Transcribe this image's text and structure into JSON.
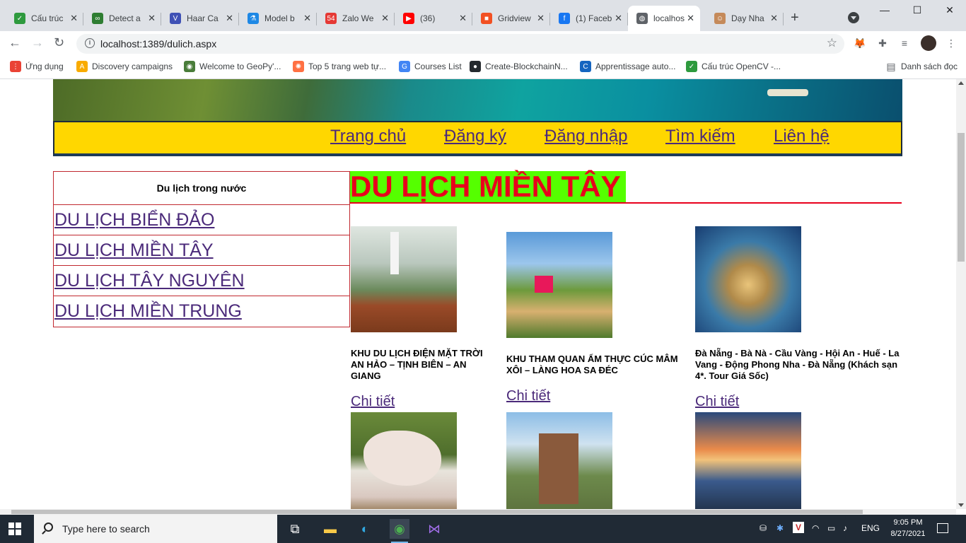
{
  "browser": {
    "tabs": [
      {
        "title": "Cấu trúc",
        "icon_color": "#2e9a3e",
        "glyph": "✓"
      },
      {
        "title": "Detect a",
        "icon_color": "#2e7d32",
        "glyph": "∞"
      },
      {
        "title": "Haar Ca",
        "icon_color": "#3f51b5",
        "glyph": "V"
      },
      {
        "title": "Model b",
        "icon_color": "#1e88e5",
        "glyph": "⚗"
      },
      {
        "title": "Zalo We",
        "icon_color": "#e53935",
        "glyph": "54"
      },
      {
        "title": "(36)",
        "icon_color": "#ff0000",
        "glyph": "▶"
      },
      {
        "title": "Gridview",
        "icon_color": "#f25022",
        "glyph": "■"
      },
      {
        "title": "(1) Faceb",
        "icon_color": "#1877f2",
        "glyph": "f"
      },
      {
        "title": "localhos",
        "icon_color": "#5f6368",
        "glyph": "◍",
        "active": true
      },
      {
        "title": "Dạy Nha",
        "icon_color": "#c58a5a",
        "glyph": "☺"
      }
    ],
    "new_tab": "+",
    "window": {
      "minimize": "—",
      "maximize": "☐",
      "close": "✕"
    },
    "nav": {
      "back": "←",
      "forward": "→",
      "reload": "↻"
    },
    "url": "localhost:1389/dulich.aspx",
    "bookmarks": [
      {
        "label": "Ứng dụng",
        "color": "#ea4335",
        "glyph": "⋮⋮⋮"
      },
      {
        "label": "Discovery campaigns",
        "color": "#f9ab00",
        "glyph": "A"
      },
      {
        "label": "Welcome to GeoPy'...",
        "color": "#4a7d3a",
        "glyph": "◉"
      },
      {
        "label": "Top 5 trang web tự...",
        "color": "#ff7043",
        "glyph": "✺"
      },
      {
        "label": "Courses List",
        "color": "#4285f4",
        "glyph": "G"
      },
      {
        "label": "Create-BlockchainN...",
        "color": "#24292e",
        "glyph": "●"
      },
      {
        "label": "Apprentissage auto...",
        "color": "#1565c0",
        "glyph": "C"
      },
      {
        "label": "Cấu trúc OpenCV -...",
        "color": "#2e9a3e",
        "glyph": "✓"
      }
    ],
    "reading_list": "Danh sách đọc"
  },
  "site": {
    "menu": [
      "Trang chủ",
      "Đăng ký",
      "Đăng nhập",
      "Tìm kiếm",
      "Liên hệ"
    ],
    "sidebar": {
      "heading": "Du lịch trong nước",
      "items": [
        "DU LỊCH BIỂN ĐẢO",
        "DU LỊCH MIỀN TÂY",
        "DU LỊCH TÂY NGUYÊN",
        "DU LỊCH MIỀN TRUNG"
      ]
    },
    "page_title": "DU LỊCH MIỀN TÂY",
    "products": [
      {
        "caption": "KHU DU LỊCH ĐIỆN MẶT TRỜI AN HẢO – TỊNH BIÊN – AN GIANG",
        "link": "Chi tiết"
      },
      {
        "caption": "KHU THAM QUAN ẨM THỰC CÚC MÂM XÔI – LÀNG HOA SA ĐÉC",
        "link": "Chi tiết"
      },
      {
        "caption": "Đà Nẵng - Bà Nà - Cầu Vàng - Hội An - Huế - La Vang - Động Phong Nha - Đà Nẵng (Khách sạn 4*. Tour Giá Sốc)",
        "link": "Chi tiết"
      }
    ]
  },
  "taskbar": {
    "search_placeholder": "Type here to search",
    "language": "ENG",
    "time": "9:05 PM",
    "date": "8/27/2021"
  }
}
